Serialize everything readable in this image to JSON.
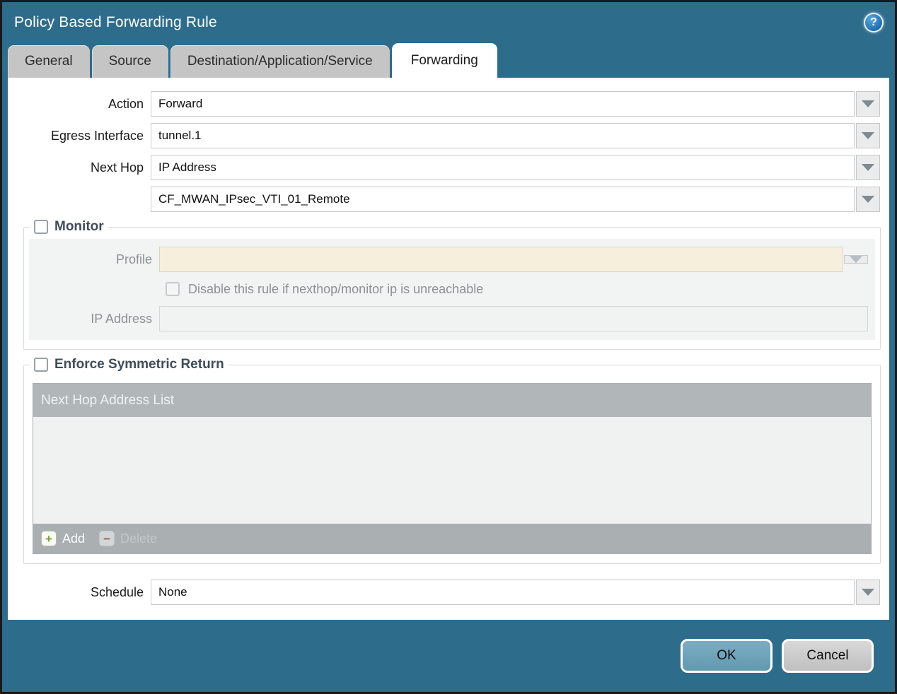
{
  "dialog": {
    "title": "Policy Based Forwarding Rule"
  },
  "icons": {
    "help": "?",
    "add": "+",
    "delete": "−"
  },
  "tabs": [
    {
      "label": "General",
      "active": false
    },
    {
      "label": "Source",
      "active": false
    },
    {
      "label": "Destination/Application/Service",
      "active": false
    },
    {
      "label": "Forwarding",
      "active": true
    }
  ],
  "form": {
    "action": {
      "label": "Action",
      "value": "Forward"
    },
    "egress_interface": {
      "label": "Egress Interface",
      "value": "tunnel.1"
    },
    "next_hop": {
      "label": "Next Hop",
      "value": "IP Address"
    },
    "next_hop_address": {
      "value": "CF_MWAN_IPsec_VTI_01_Remote"
    },
    "schedule": {
      "label": "Schedule",
      "value": "None"
    }
  },
  "monitor": {
    "legend": "Monitor",
    "checked": false,
    "enabled": false,
    "profile": {
      "label": "Profile",
      "value": ""
    },
    "disable_rule_checkbox": {
      "label": "Disable this rule if nexthop/monitor ip is unreachable",
      "checked": false
    },
    "ip_address": {
      "label": "IP Address",
      "value": ""
    }
  },
  "symmetric_return": {
    "legend": "Enforce Symmetric Return",
    "checked": false,
    "table": {
      "header": "Next Hop Address List",
      "rows": [],
      "add_label": "Add",
      "delete_label": "Delete",
      "delete_enabled": false
    }
  },
  "footer": {
    "ok_label": "OK",
    "cancel_label": "Cancel"
  },
  "colors": {
    "dialog_background": "#2e6c8c",
    "active_tab": "#ffffff",
    "inactive_tab": "#c5c5c5",
    "disabled_field": "#f5efdc",
    "table_header": "#b1b6b9",
    "ok_button": "#6ca2b9",
    "add_icon_green": "#7da23b",
    "delete_icon_red": "#9b5a55"
  }
}
